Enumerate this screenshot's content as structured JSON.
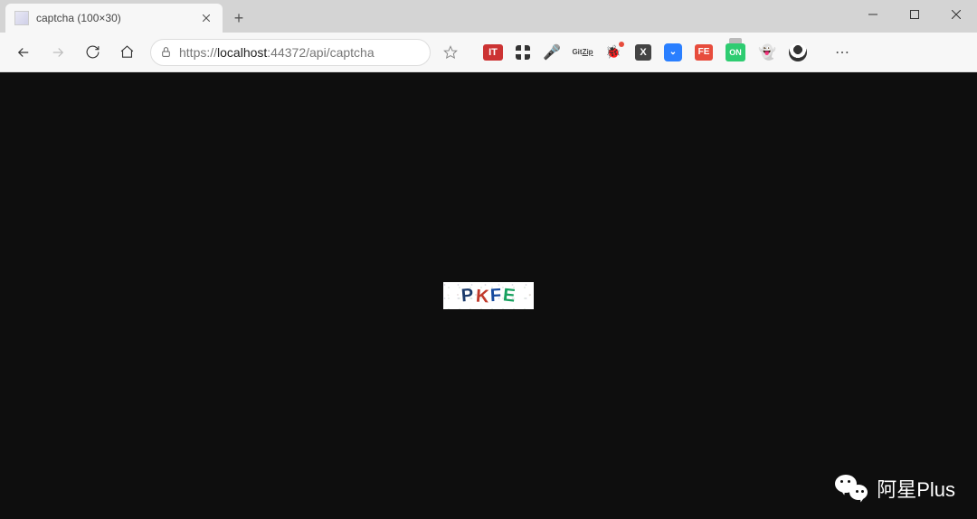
{
  "window": {
    "title": "captcha (100×30)"
  },
  "tab": {
    "title": "captcha (100×30)"
  },
  "address": {
    "scheme": "https://",
    "host": "localhost",
    "port": ":44372",
    "path": "/api/captcha"
  },
  "extensions": {
    "it": "IT",
    "gitzip_line1": "Git",
    "gitzip_line2": "Zip",
    "x": "X",
    "blue_glyph": "⌄",
    "fe": "FE",
    "on": "ON"
  },
  "captcha": {
    "width": 100,
    "height": 30,
    "chars": [
      "P",
      "K",
      "F",
      "E"
    ],
    "colors": [
      "#1a3a6b",
      "#c0392b",
      "#164a9e",
      "#16a05e"
    ]
  },
  "watermark": {
    "text": "阿星Plus"
  }
}
